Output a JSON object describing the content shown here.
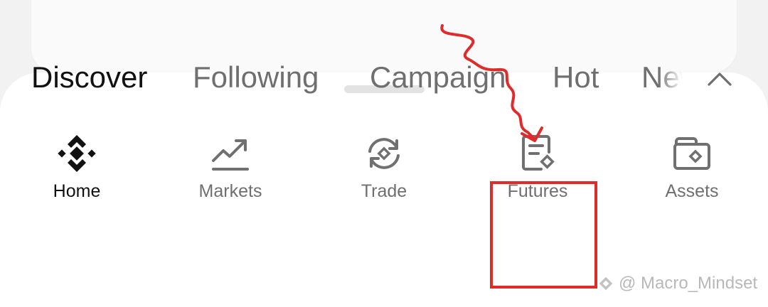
{
  "tabs": [
    {
      "label": "Discover",
      "active": true
    },
    {
      "label": "Following",
      "active": false
    },
    {
      "label": "Campaign",
      "active": false
    },
    {
      "label": "Hot",
      "active": false
    },
    {
      "label": "New",
      "active": false
    }
  ],
  "collapse_icon": "chevron-up-icon",
  "nav": [
    {
      "label": "Home",
      "icon": "binance-logo-icon",
      "active": true
    },
    {
      "label": "Markets",
      "icon": "chart-line-icon",
      "active": false
    },
    {
      "label": "Trade",
      "icon": "trade-swap-icon",
      "active": false
    },
    {
      "label": "Futures",
      "icon": "futures-document-icon",
      "active": false
    },
    {
      "label": "Assets",
      "icon": "wallet-icon",
      "active": false
    }
  ],
  "annotation": {
    "color": "#e02b2b",
    "highlighted_item": "Futures"
  },
  "watermark": {
    "text": "@ Macro_Mindset"
  },
  "colors": {
    "active_text": "#111111",
    "inactive_text": "#6f6f6f",
    "sheet_bg": "#ffffff"
  }
}
